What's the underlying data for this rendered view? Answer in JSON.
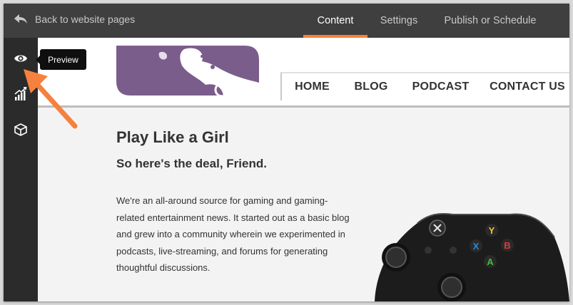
{
  "editor": {
    "back_label": "Back to website pages",
    "tabs": [
      {
        "label": "Content",
        "active": true
      },
      {
        "label": "Settings",
        "active": false
      },
      {
        "label": "Publish or Schedule",
        "active": false
      }
    ],
    "sidebar": [
      {
        "icon": "eye-icon"
      },
      {
        "icon": "bar-chart-icon"
      },
      {
        "icon": "cube-icon"
      }
    ],
    "tooltip": "Preview",
    "accent_color": "#f5813e"
  },
  "site": {
    "nav": [
      "HOME",
      "BLOG",
      "PODCAST",
      "CONTACT US"
    ],
    "logo_color": "#7b5d8c",
    "headline": "Play Like a Girl",
    "subhead": "So here's the deal, Friend.",
    "body": "We're an all-around source for gaming and gaming-related entertainment news. It started out as a basic blog and grew into a community wherein we experimented in podcasts, live-streaming, and forums for generating thoughtful discussions."
  }
}
